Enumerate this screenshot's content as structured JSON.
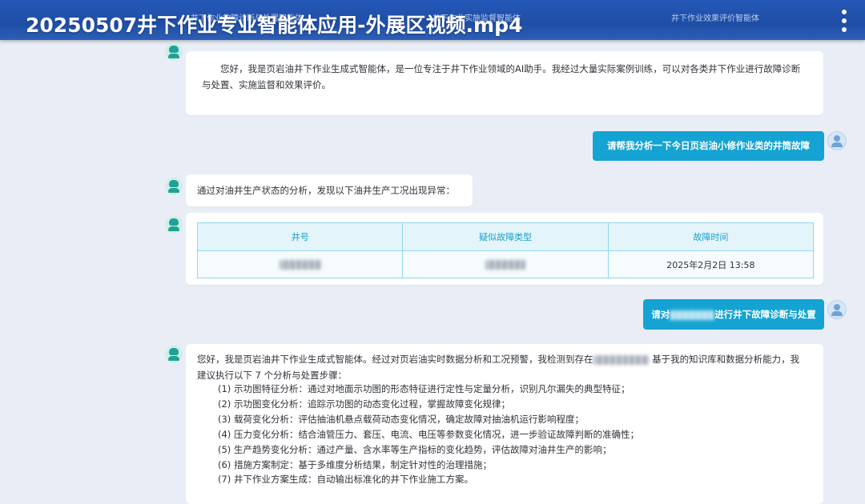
{
  "header": {
    "video_title": "20250507井下作业专业智能体应用-外展区视频.mp4",
    "tabs": [
      {
        "label": "井下作业故障诊断与处置智能体"
      },
      {
        "label": "井下作业实施监督智能体"
      },
      {
        "label": "井下作业效果评价智能体"
      }
    ],
    "more_icon": "more-vertical-icon"
  },
  "chat": {
    "intro": "您好，我是页岩油井下作业生成式智能体，是一位专注于井下作业领域的AI助手。我经过大量实际案例训练，可以对各类井下作业进行故障诊断与处置、实施监督和效果评价。",
    "user_msg_1": "请帮我分析一下今日页岩油小修作业类的井筒故障",
    "bot_msg_1": "通过对油井生产状态的分析，发现以下油井生产工况出现异常：",
    "table": {
      "headers": [
        "井号",
        "疑似故障类型",
        "故障时间"
      ],
      "rows": [
        {
          "fault_time": "2025年2月2日 13:58"
        }
      ]
    },
    "user_msg_2_prefix": "请对",
    "user_msg_2_suffix": "进行井下故障诊断与处置",
    "bot_msg_2_prefix": "您好，我是页岩油井下作业生成式智能体。经过对页岩油实时数据分析和工况预警，我检测到存在",
    "bot_msg_2_suffix": "基于我的知识库和数据分析能力，我建议执行以下 7 个分析与处置步骤：",
    "steps": [
      "(1) 示功图特征分析：通过对地面示功图的形态特征进行定性与定量分析，识别凡尔漏失的典型特征；",
      "(2) 示功图变化分析：追踪示功图的动态变化过程，掌握故障变化规律；",
      "(3) 载荷变化分析：评估抽油机悬点载荷动态变化情况，确定故障对抽油机运行影响程度；",
      "(4) 压力变化分析：结合油管压力、套压、电流、电压等参数变化情况，进一步验证故障判断的准确性；",
      "(5) 生产趋势变化分析：通过产量、含水率等生产指标的变化趋势，评估故障对油井生产的影响；",
      "(6) 措施方案制定：基于多维度分析结果，制定针对性的治理措施；",
      "(7) 井下作业方案生成：自动输出标准化的井下作业施工方案。"
    ],
    "colors": {
      "user_bubble": "#15a3d3",
      "bot_avatar": "#1fa295",
      "table_header": "#19a1c9"
    }
  }
}
